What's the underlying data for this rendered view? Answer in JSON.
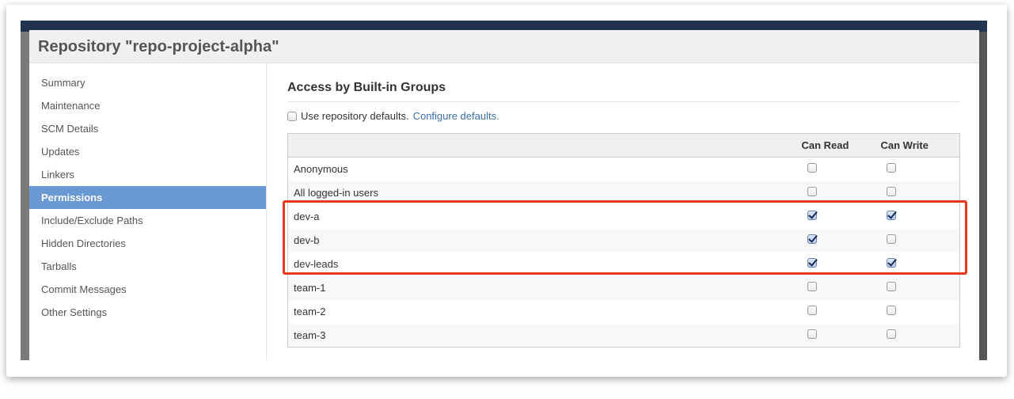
{
  "modal": {
    "title": "Repository \"repo-project-alpha\""
  },
  "sidebar": {
    "items": [
      {
        "label": "Summary"
      },
      {
        "label": "Maintenance"
      },
      {
        "label": "SCM Details"
      },
      {
        "label": "Updates"
      },
      {
        "label": "Linkers"
      },
      {
        "label": "Permissions",
        "active": true
      },
      {
        "label": "Include/Exclude Paths"
      },
      {
        "label": "Hidden Directories"
      },
      {
        "label": "Tarballs"
      },
      {
        "label": "Commit Messages"
      },
      {
        "label": "Other Settings"
      }
    ]
  },
  "main": {
    "heading": "Access by Built-in Groups",
    "use_defaults_label": "Use repository defaults.",
    "use_defaults_checked": false,
    "configure_link": "Configure defaults.",
    "columns": [
      "",
      "Can Read",
      "Can Write"
    ],
    "rows": [
      {
        "name": "Anonymous",
        "read": false,
        "write": false
      },
      {
        "name": "All logged-in users",
        "read": false,
        "write": false
      },
      {
        "name": "dev-a",
        "read": true,
        "write": true
      },
      {
        "name": "dev-b",
        "read": true,
        "write": false
      },
      {
        "name": "dev-leads",
        "read": true,
        "write": true
      },
      {
        "name": "team-1",
        "read": false,
        "write": false
      },
      {
        "name": "team-2",
        "read": false,
        "write": false
      },
      {
        "name": "team-3",
        "read": false,
        "write": false
      }
    ]
  },
  "colors": {
    "active_item": "#6a98d2",
    "highlight_box": "#e8391e",
    "link": "#3a6ea5"
  }
}
